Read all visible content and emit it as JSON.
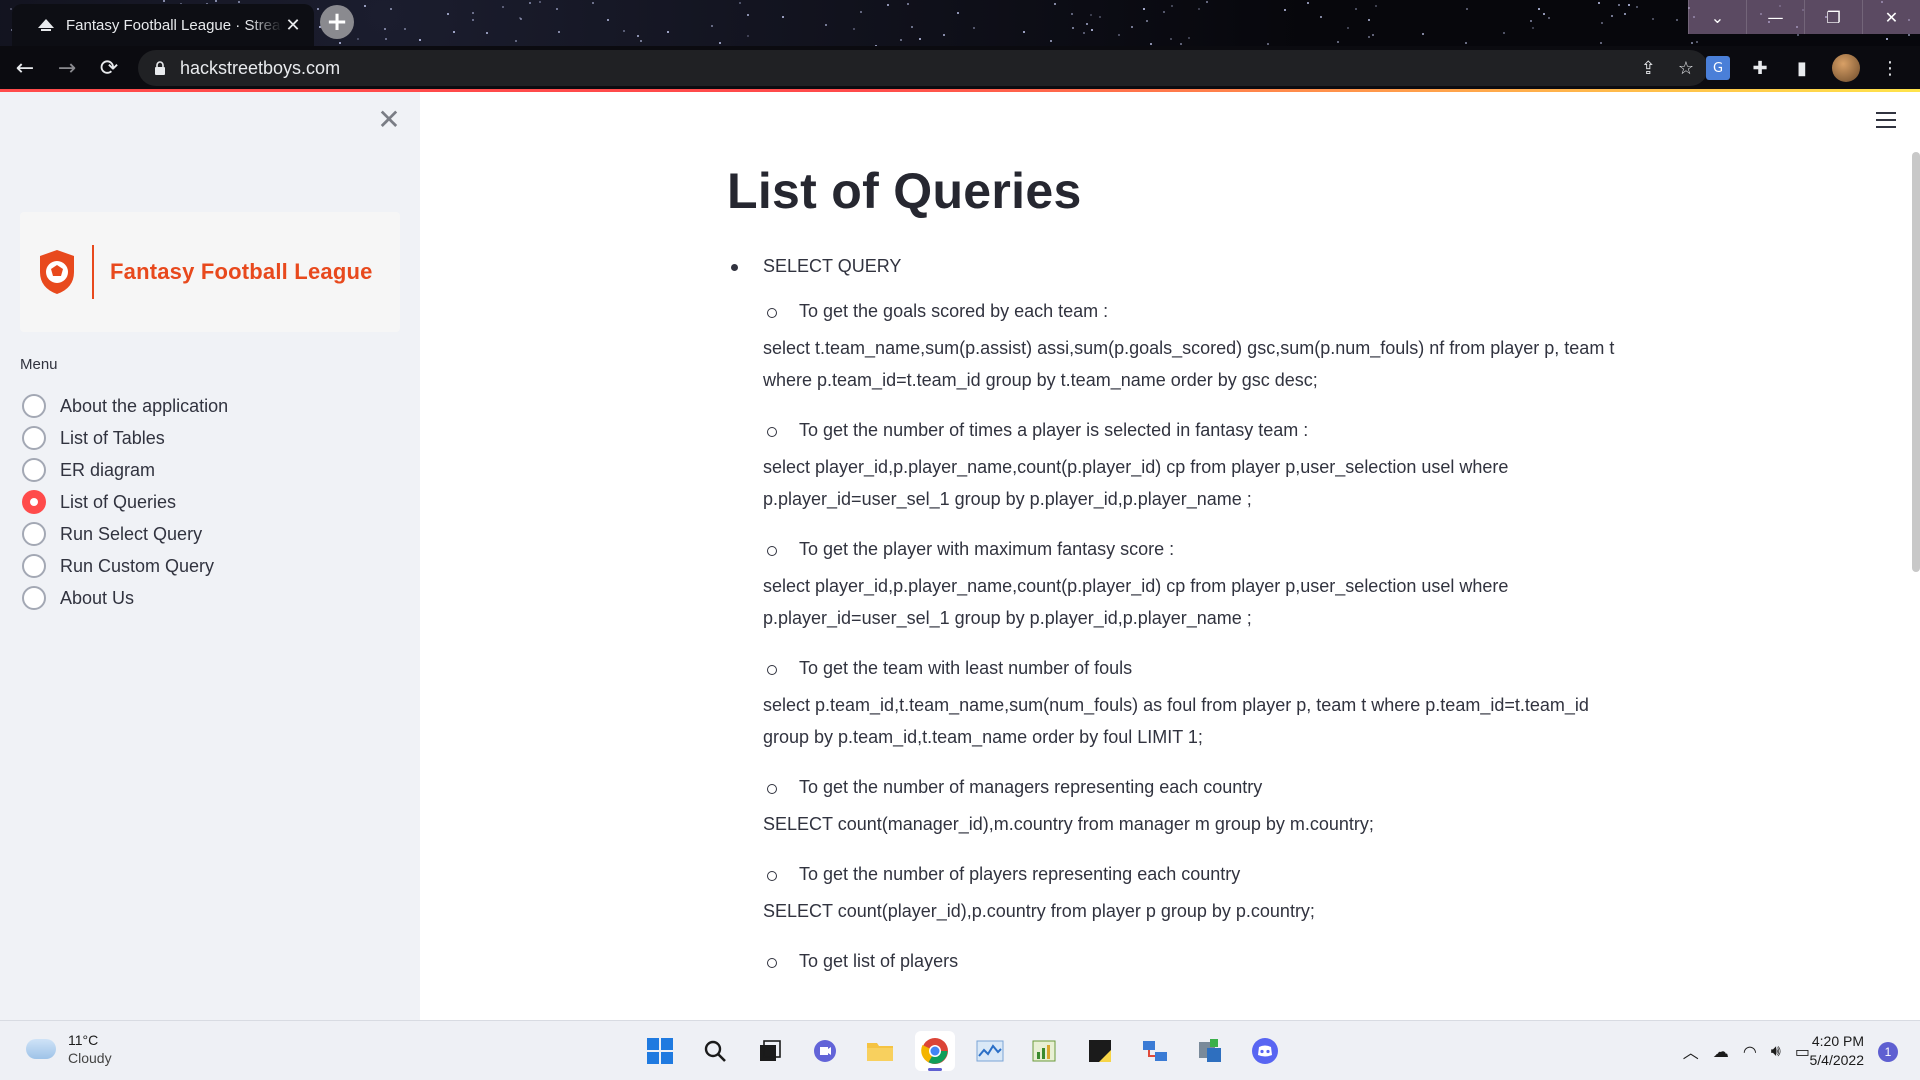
{
  "browser": {
    "tab_title": "Fantasy Football League · Streamlit",
    "new_tab_icon": "plus-icon",
    "url": "hackstreetboys.com",
    "window_controls": [
      "chevron-down-icon",
      "minimize-icon",
      "restore-icon",
      "close-icon"
    ]
  },
  "sidebar": {
    "logo_text": "Fantasy Football League",
    "menu_label": "Menu",
    "items": [
      {
        "label": "About the application",
        "checked": false
      },
      {
        "label": "List of Tables",
        "checked": false
      },
      {
        "label": "ER diagram",
        "checked": false
      },
      {
        "label": "List of Queries",
        "checked": true
      },
      {
        "label": "Run Select Query",
        "checked": false
      },
      {
        "label": "Run Custom Query",
        "checked": false
      },
      {
        "label": "About Us",
        "checked": false
      }
    ],
    "accent_color": "#ff4b4b"
  },
  "main": {
    "title": "List of Queries",
    "section": "SELECT QUERY",
    "queries": [
      {
        "title": "To get the goals scored by each team :",
        "sql": "select t.team_name,sum(p.assist) assi,sum(p.goals_scored) gsc,sum(p.num_fouls) nf from player p, team t where p.team_id=t.team_id group by t.team_name order by gsc desc;"
      },
      {
        "title": "To get the number of times a player is selected in fantasy team :",
        "sql": "select player_id,p.player_name,count(p.player_id) cp from player p,user_selection usel where p.player_id=user_sel_1 group by p.player_id,p.player_name ;"
      },
      {
        "title": "To get the player with maximum fantasy score :",
        "sql": "select player_id,p.player_name,count(p.player_id) cp from player p,user_selection usel where p.player_id=user_sel_1 group by p.player_id,p.player_name ;"
      },
      {
        "title": "To get the team with least number of fouls",
        "sql": "select p.team_id,t.team_name,sum(num_fouls) as foul from player p, team t where p.team_id=t.team_id group by p.team_id,t.team_name order by foul LIMIT 1;"
      },
      {
        "title": "To get the number of managers representing each country",
        "sql": "SELECT count(manager_id),m.country from manager m group by m.country;"
      },
      {
        "title": "To get the number of players representing each country",
        "sql": "SELECT count(player_id),p.country from player p group by p.country;"
      },
      {
        "title": "To get list of players",
        "sql": ""
      }
    ]
  },
  "taskbar": {
    "weather_temp": "11°C",
    "weather_desc": "Cloudy",
    "time": "4:20 PM",
    "date": "5/4/2022",
    "notification_count": "1"
  }
}
